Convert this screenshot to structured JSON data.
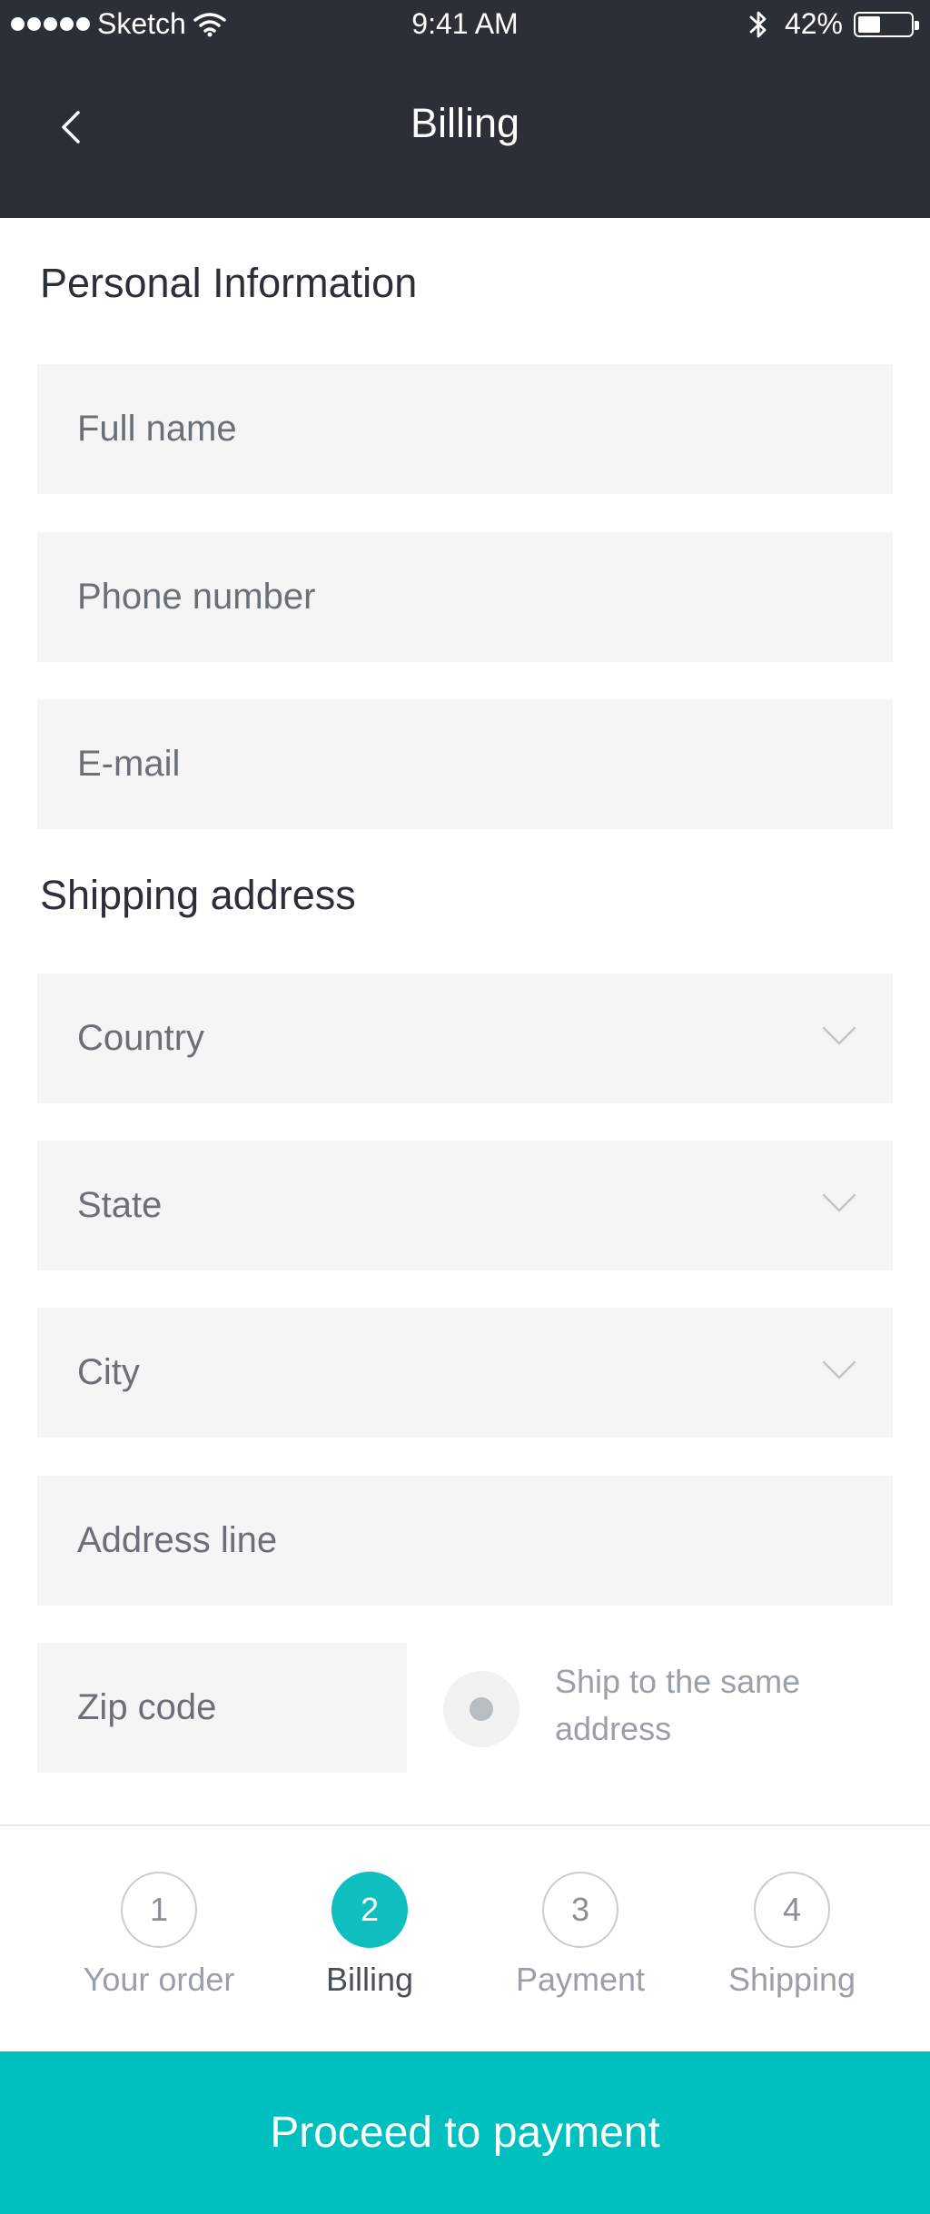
{
  "status_bar": {
    "carrier": "Sketch",
    "time": "9:41 AM",
    "battery": "42%",
    "battery_level": 0.42
  },
  "nav": {
    "title": "Billing",
    "back_icon": "chevron-left-icon"
  },
  "personal": {
    "title": "Personal Information",
    "full_name_placeholder": "Full name",
    "phone_placeholder": "Phone number",
    "email_placeholder": "E-mail"
  },
  "shipping": {
    "title": "Shipping address",
    "country": "Country",
    "state": "State",
    "city": "City",
    "address_placeholder": "Address line",
    "zip_placeholder": "Zip code",
    "same_address_label": "Ship to the same address"
  },
  "steps": [
    {
      "number": "1",
      "label": "Your order",
      "active": false
    },
    {
      "number": "2",
      "label": "Billing",
      "active": true
    },
    {
      "number": "3",
      "label": "Payment",
      "active": false
    },
    {
      "number": "4",
      "label": "Shipping",
      "active": false
    }
  ],
  "cta": {
    "label": "Proceed to payment"
  },
  "colors": {
    "header_bg": "#2a2f38",
    "accent": "#00bfbf",
    "field_bg": "#f5f5f5"
  }
}
